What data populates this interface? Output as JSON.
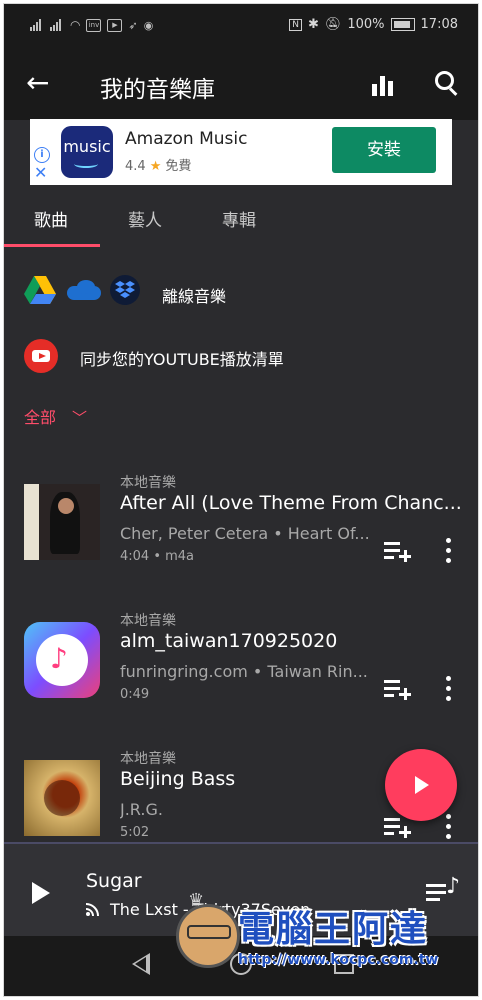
{
  "status_bar": {
    "left_icons": [
      "signal-icon",
      "signal-icon",
      "wifi-icon",
      "app-badge-icon",
      "youtube-icon",
      "rocket-icon",
      "messenger-icon"
    ],
    "nfc": "N",
    "battery": "100%",
    "time": "17:08"
  },
  "app_bar": {
    "title": "我的音樂庫"
  },
  "ad": {
    "logo_text": "music",
    "app_name": "Amazon Music",
    "rating": "4.4",
    "price": "免費",
    "install_label": "安裝"
  },
  "tabs": [
    {
      "label": "歌曲",
      "active": true
    },
    {
      "label": "藝人",
      "active": false
    },
    {
      "label": "專輯",
      "active": false
    }
  ],
  "offline": {
    "label": "離線音樂"
  },
  "youtube_sync": {
    "label": "同步您的YOUTUBE播放清單"
  },
  "filter": {
    "label": "全部"
  },
  "songs": [
    {
      "source": "本地音樂",
      "title": "After All (Love Theme From Chanc...",
      "artist": "Cher, Peter Cetera • Heart Of...",
      "meta": "4:04 • m4a"
    },
    {
      "source": "本地音樂",
      "title": "alm_taiwan170925020",
      "artist": "funringring.com • Taiwan Rin...",
      "meta": "0:49"
    },
    {
      "source": "本地音樂",
      "title": "Beijing Bass",
      "artist": "J.R.G.",
      "meta": "5:02"
    }
  ],
  "now_playing": {
    "title": "Sugar",
    "subtitle": "The Lxst - Thirty37Seven"
  },
  "watermark": {
    "name": "電腦王阿達",
    "url": "http://www.kocpc.com.tw"
  },
  "colors": {
    "accent": "#ff4d6a",
    "background": "#2b2b2e",
    "install_button": "#0d8a63"
  }
}
